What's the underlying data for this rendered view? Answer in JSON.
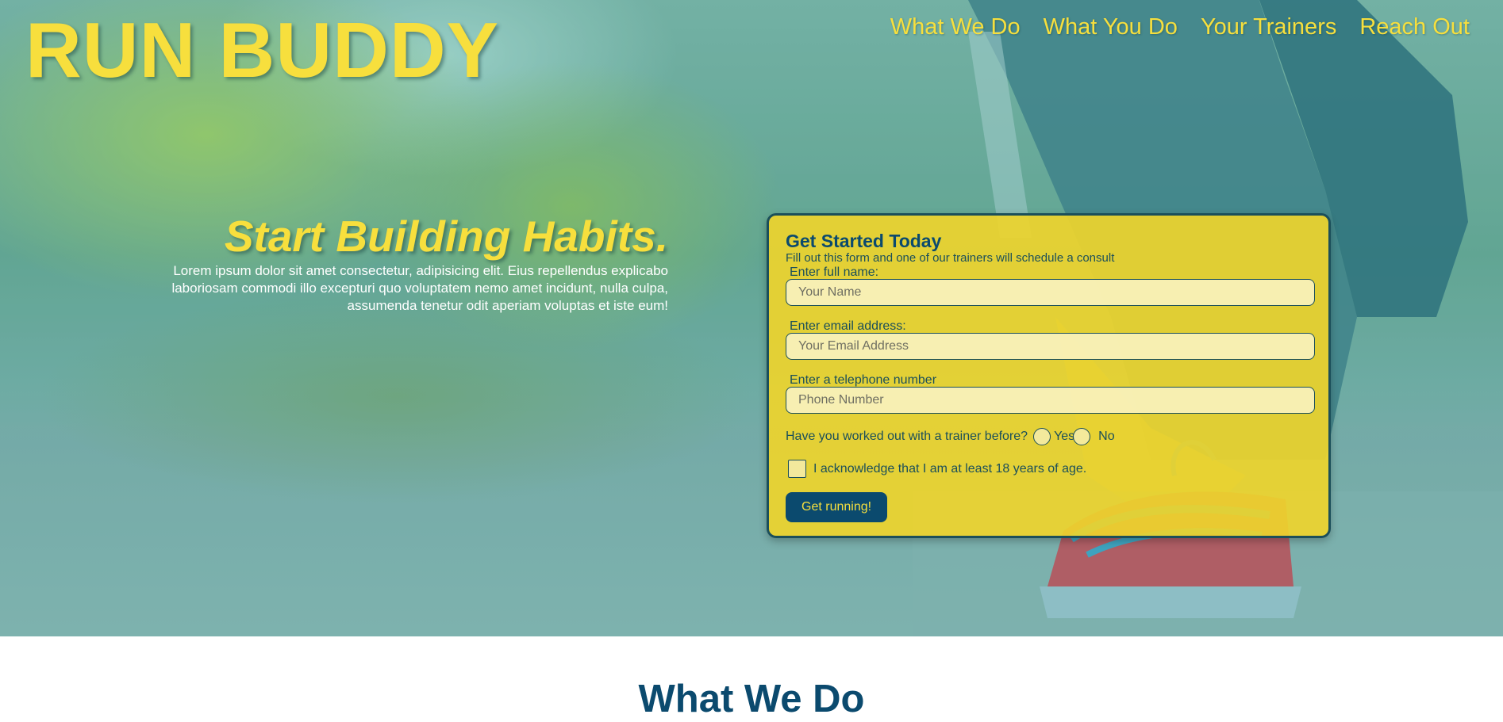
{
  "brand": {
    "name": "RUN BUDDY"
  },
  "nav": {
    "items": [
      {
        "label": "What We Do"
      },
      {
        "label": "What You Do"
      },
      {
        "label": "Your Trainers"
      },
      {
        "label": "Reach Out"
      }
    ]
  },
  "intro": {
    "heading": "Start Building Habits.",
    "text": "Lorem ipsum dolor sit amet consectetur, adipisicing elit. Eius repellendus explicabo laboriosam commodi illo excepturi quo voluptatem nemo amet incidunt, nulla culpa, assumenda tenetur odit aperiam voluptas et iste eum!"
  },
  "form": {
    "title": "Get Started Today",
    "subtitle": "Fill out this form and one of our trainers will schedule a consult",
    "name": {
      "label": "Enter full name:",
      "placeholder": "Your Name",
      "value": ""
    },
    "email": {
      "label": "Enter email address:",
      "placeholder": "Your Email Address",
      "value": ""
    },
    "phone": {
      "label": "Enter a telephone number",
      "placeholder": "Phone Number",
      "value": ""
    },
    "trainer_question": "Have you worked out with a trainer before?",
    "yes_label": "Yes",
    "no_label": "No",
    "acknowledge": "I acknowledge that I am at least 18 years of age.",
    "submit_label": "Get running!"
  },
  "section": {
    "title": "What We Do"
  },
  "colors": {
    "accent_yellow": "#f7df3d",
    "primary_blue": "#0b4a6e",
    "dark_teal": "#1b4f5a"
  }
}
